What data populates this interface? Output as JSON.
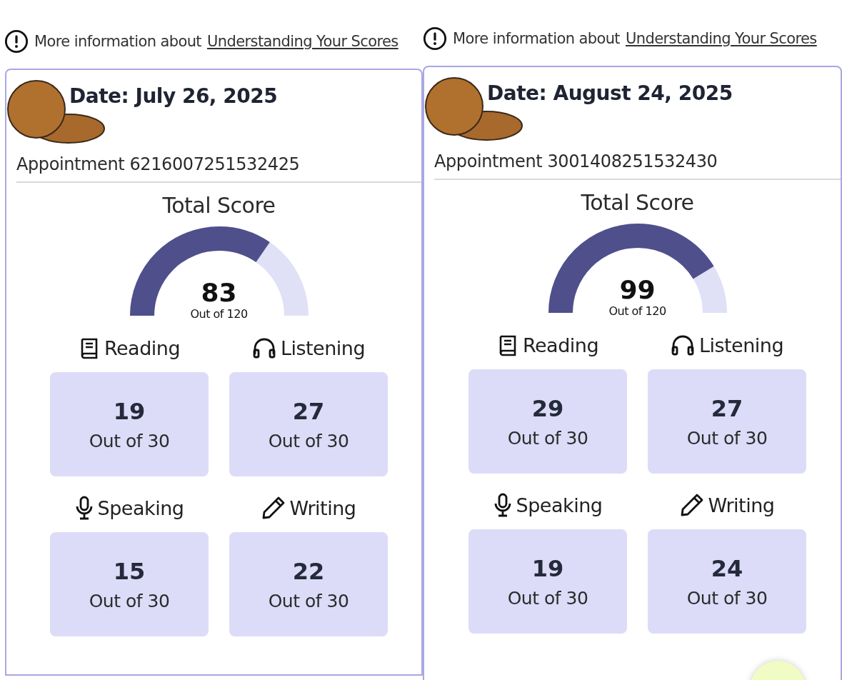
{
  "panels": [
    {
      "notice": {
        "text": "More information about",
        "link": "Understanding Your Scores"
      },
      "title": "Date: July 26, 2025",
      "appointment": "Appointment 6216007251532425",
      "total": {
        "label": "Total Score",
        "score": "83",
        "out_of": "Out of 120"
      },
      "sections": [
        {
          "kind": "reading",
          "label": "Reading",
          "score": "19",
          "out_of": "Out of 30"
        },
        {
          "kind": "listening",
          "label": "Listening",
          "score": "27",
          "out_of": "Out of 30"
        },
        {
          "kind": "speaking",
          "label": "Speaking",
          "score": "15",
          "out_of": "Out of 30"
        },
        {
          "kind": "writing",
          "label": "Writing",
          "score": "22",
          "out_of": "Out of 30"
        }
      ]
    },
    {
      "notice": {
        "text": "More information about",
        "link": "Understanding Your Scores"
      },
      "title": "Date: August 24, 2025",
      "appointment": "Appointment 3001408251532430",
      "total": {
        "label": "Total Score",
        "score": "99",
        "out_of": "Out of 120"
      },
      "sections": [
        {
          "kind": "reading",
          "label": "Reading",
          "score": "29",
          "out_of": "Out of 30"
        },
        {
          "kind": "listening",
          "label": "Listening",
          "score": "27",
          "out_of": "Out of 30"
        },
        {
          "kind": "speaking",
          "label": "Speaking",
          "score": "19",
          "out_of": "Out of 30"
        },
        {
          "kind": "writing",
          "label": "Writing",
          "score": "24",
          "out_of": "Out of 30"
        }
      ]
    }
  ]
}
